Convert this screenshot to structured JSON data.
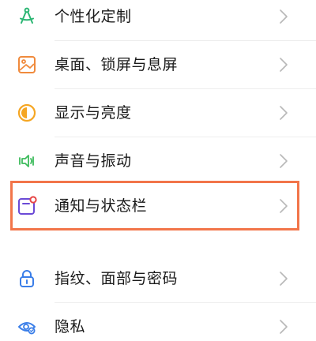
{
  "settings_list": {
    "items": [
      {
        "label": "个性化定制",
        "icon": "brush-icon",
        "color": "#2bb673"
      },
      {
        "label": "桌面、锁屏与息屏",
        "icon": "wallpaper-icon",
        "color": "#f08a3c"
      },
      {
        "label": "显示与亮度",
        "icon": "brightness-icon",
        "color": "#f5a623"
      },
      {
        "label": "声音与振动",
        "icon": "speaker-icon",
        "color": "#3dbb5c"
      },
      {
        "label": "通知与状态栏",
        "icon": "notification-icon",
        "color": "#6b4ad6",
        "badge_color": "#e64545"
      },
      {
        "label": "指纹、面部与密码",
        "icon": "lock-icon",
        "color": "#3a7ee8"
      },
      {
        "label": "隐私",
        "icon": "privacy-icon",
        "color": "#3a7ee8"
      }
    ]
  },
  "colors": {
    "highlight_border": "#f2754a",
    "chevron": "#b8b8b8",
    "text": "#1a1a1a"
  }
}
